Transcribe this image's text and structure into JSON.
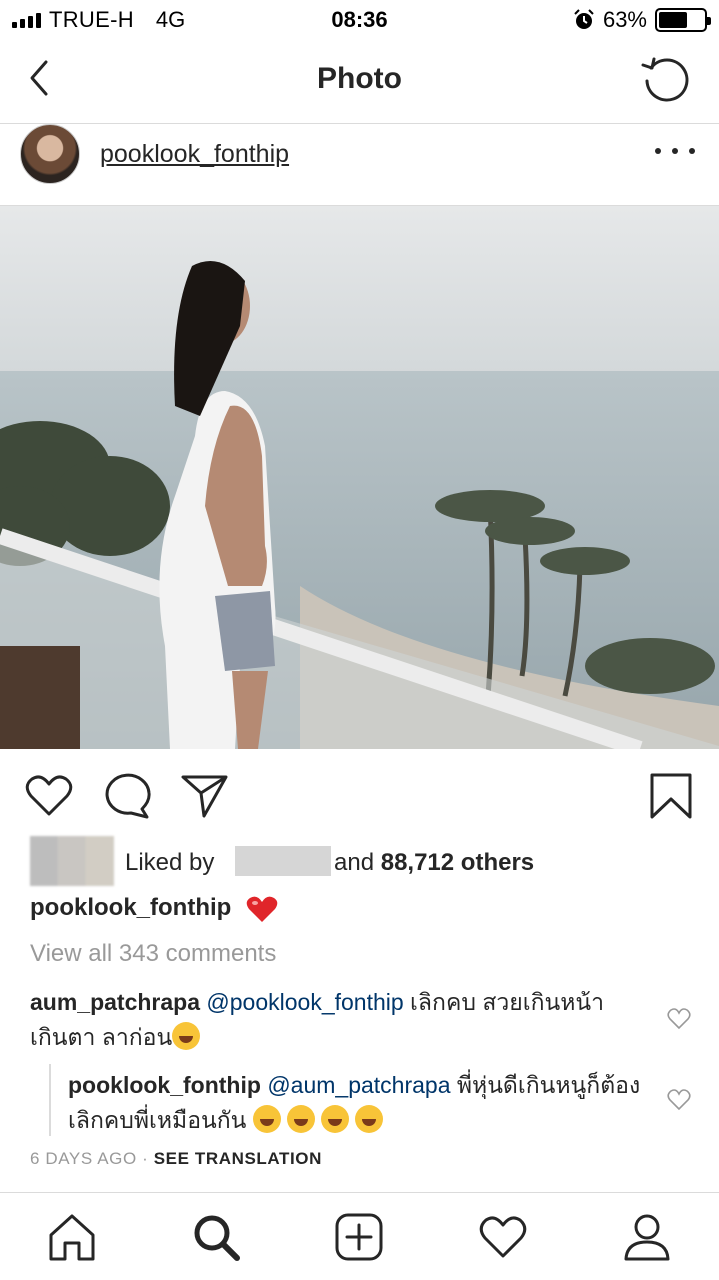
{
  "status_bar": {
    "carrier": "TRUE-H",
    "network": "4G",
    "time": "08:36",
    "battery_percent": "63%",
    "battery_level": 0.63,
    "alarm_icon": "alarm-icon"
  },
  "nav": {
    "title": "Photo",
    "back_icon": "chevron-left-icon",
    "refresh_icon": "refresh-icon"
  },
  "post": {
    "username": "pooklook_fonthip",
    "more_icon": "more-dots-icon",
    "likes": {
      "prefix": "Liked by",
      "mid": "and",
      "count": "88,712 others"
    },
    "caption": {
      "username": "pooklook_fonthip",
      "emoji": "red-heart-emoji"
    },
    "view_all": "View all 343 comments",
    "comments": [
      {
        "user": "aum_patchrapa",
        "mention": "@pooklook_fonthip",
        "text": " เลิกคบ สวยเกินหน้าเกินตา ลาก่อน"
      },
      {
        "user": "pooklook_fonthip",
        "mention": "@aum_patchrapa",
        "text": " พี่หุ่นดีเกินหนูก็ต้องเลิกคบพี่เหมือนกัน "
      }
    ],
    "timestamp": "6 DAYS AGO",
    "separator": "·",
    "translate": "SEE TRANSLATION"
  },
  "colors": {
    "text": "#262626",
    "muted": "#999999",
    "mention": "#003569",
    "heart": "#ed4956",
    "divider": "#dbdbdb"
  }
}
